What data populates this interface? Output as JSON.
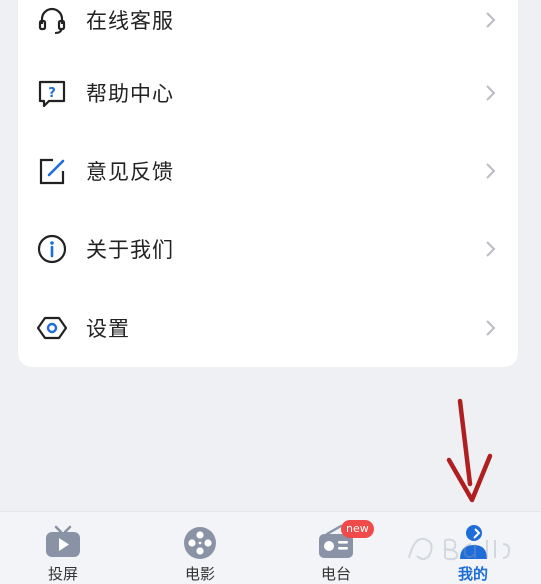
{
  "menu": {
    "items": [
      {
        "label": "在线客服",
        "icon": "headset-icon"
      },
      {
        "label": "帮助中心",
        "icon": "help-question-icon"
      },
      {
        "label": "意见反馈",
        "icon": "edit-feedback-icon"
      },
      {
        "label": "关于我们",
        "icon": "info-icon"
      },
      {
        "label": "设置",
        "icon": "settings-hexagon-icon"
      }
    ]
  },
  "tabbar": {
    "tabs": [
      {
        "label": "投屏",
        "icon": "tv-play-icon"
      },
      {
        "label": "电影",
        "icon": "film-reel-icon"
      },
      {
        "label": "电台",
        "icon": "radio-icon",
        "badge": "new"
      },
      {
        "label": "我的",
        "icon": "user-profile-icon",
        "active": true
      }
    ]
  },
  "annotation": {
    "icon": "red-down-arrow-icon",
    "color": "#b01f1f"
  },
  "colors": {
    "accent": "#1e6dd8",
    "icon_gray": "#8a93a6",
    "badge": "#f04a4a"
  }
}
